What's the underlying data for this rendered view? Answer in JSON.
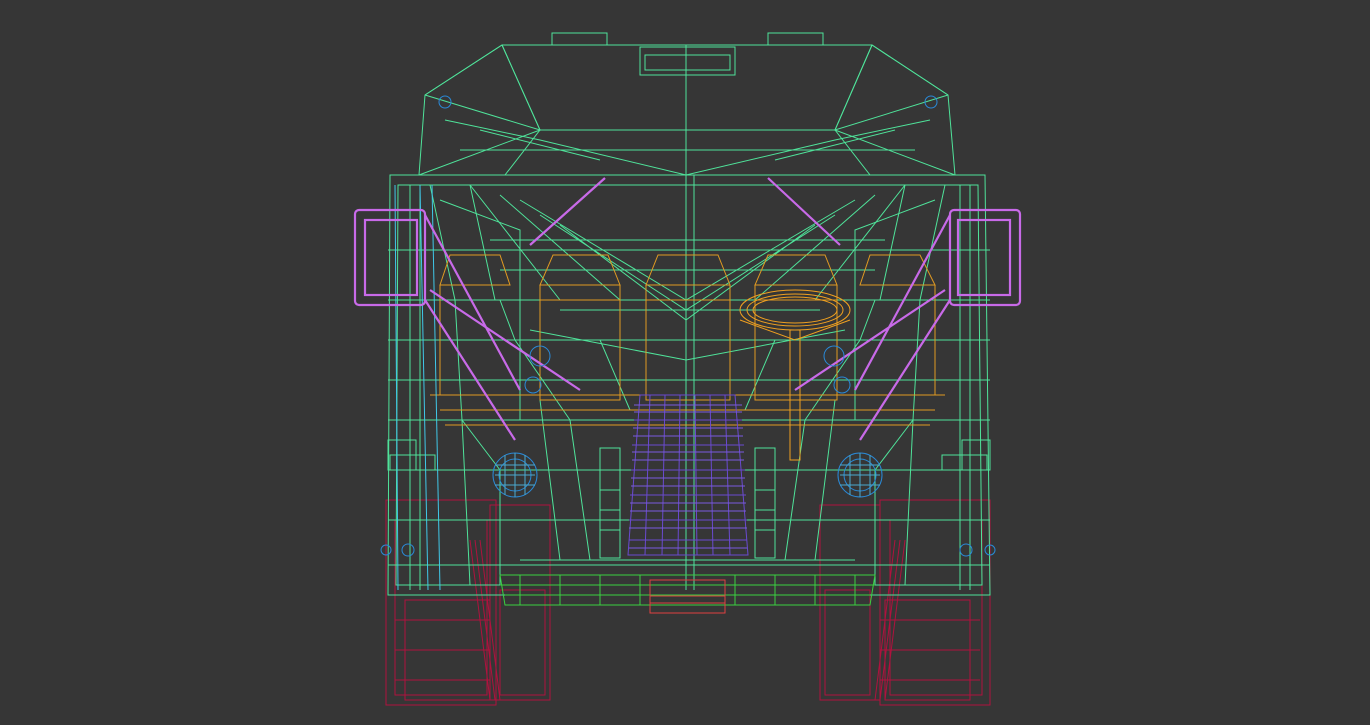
{
  "viewport": {
    "background": "#363636",
    "view": "front",
    "render_mode": "wireframe"
  },
  "layers": [
    {
      "name": "body-shell",
      "color": "#4fe39a"
    },
    {
      "name": "seats",
      "color": "#e09a22"
    },
    {
      "name": "steering-wheel",
      "color": "#f0a020"
    },
    {
      "name": "mirrors",
      "color": "#c86ae8"
    },
    {
      "name": "wheels",
      "color": "#b0123e"
    },
    {
      "name": "cockpit-panel",
      "color": "#6a4ad0"
    },
    {
      "name": "lights",
      "color": "#2a8ad8"
    },
    {
      "name": "bumper",
      "color": "#3ad040"
    },
    {
      "name": "pillar",
      "color": "#40c8e8"
    },
    {
      "name": "hitch",
      "color": "#e04040"
    }
  ]
}
